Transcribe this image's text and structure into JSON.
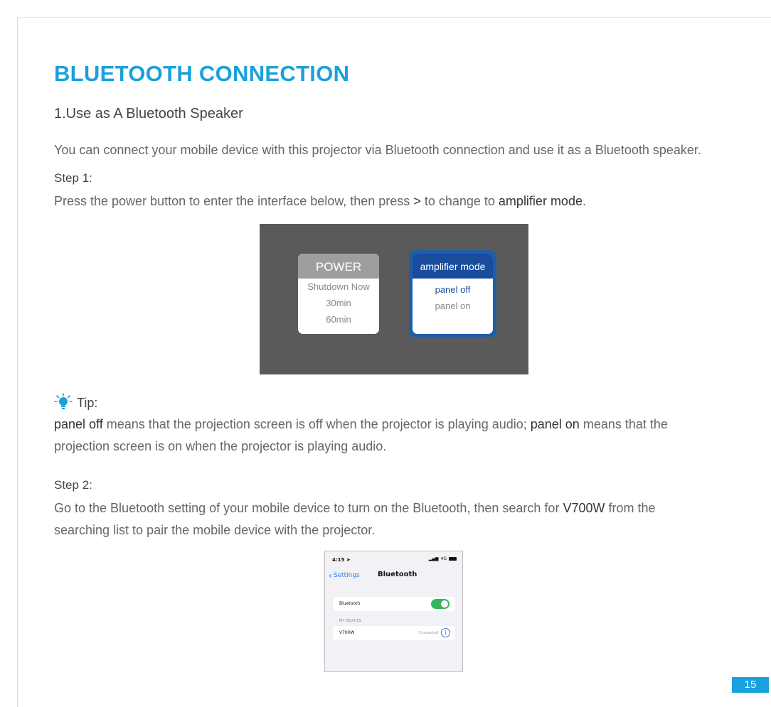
{
  "document": {
    "title": "BLUETOOTH CONNECTION",
    "section_heading": "1.Use as A Bluetooth Speaker",
    "intro": "You can connect your mobile device with this projector via Bluetooth connection and use it as a Bluetooth speaker.",
    "step1": {
      "label": "Step 1:",
      "text_before": "Press the power button to enter the interface below, then press ",
      "key_symbol": ">",
      "text_middle": " to change to ",
      "emphasis": "amplifier mode",
      "text_after": "."
    },
    "projector_menu": {
      "power_card": {
        "title": "POWER",
        "options": [
          "Shutdown Now",
          "30min",
          "60min"
        ]
      },
      "amplifier_card": {
        "title": "amplifier mode",
        "options": [
          "panel off",
          "panel on"
        ]
      }
    },
    "tip": {
      "label": "Tip:",
      "icon": "lightbulb-icon",
      "term1": "panel off",
      "text1": " means that the projection screen is off when the projector is playing audio; ",
      "term2": "panel on",
      "text2": " means that the",
      "line2": "projection screen is on when the projector is playing audio."
    },
    "step2": {
      "label": "Step 2:",
      "line1_before": "Go to the Bluetooth setting of your mobile device to turn on the Bluetooth, then search for ",
      "device_name": "V700W",
      "line1_after": " from the",
      "line2": "searching list to pair the mobile device with the projector."
    },
    "phone_screenshot": {
      "time": "4:15",
      "network": "4G",
      "back_label": "Settings",
      "screen_title": "Bluetooth",
      "bluetooth_row_label": "Bluetooth",
      "bluetooth_on": true,
      "section_label": "MY DEVICES",
      "device_name": "V700W",
      "device_status": "Connected"
    },
    "page_number": "15"
  },
  "colors": {
    "title_blue": "#1aa0dc",
    "menu_blue": "#1a4c9c",
    "screen_gray": "#5a5a5a",
    "toggle_green": "#34b75a"
  }
}
